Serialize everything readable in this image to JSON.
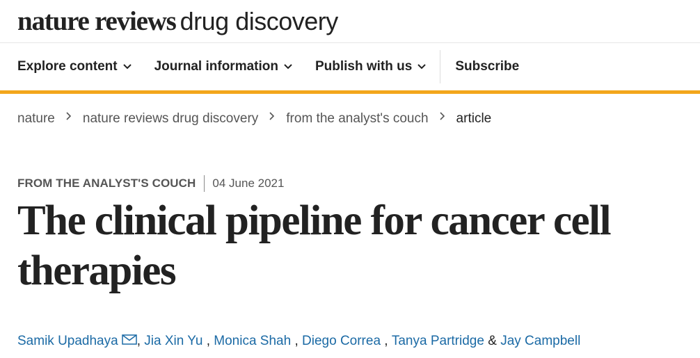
{
  "masthead": {
    "logo_bold": "nature reviews",
    "logo_light": "drug discovery"
  },
  "nav": {
    "items": [
      {
        "label": "Explore content"
      },
      {
        "label": "Journal information"
      },
      {
        "label": "Publish with us"
      }
    ],
    "subscribe": "Subscribe"
  },
  "breadcrumb": [
    "nature",
    "nature reviews drug discovery",
    "from the analyst's couch",
    "article"
  ],
  "article": {
    "type": "FROM THE ANALYST'S COUCH",
    "date": "04 June 2021",
    "title": "The clinical pipeline for cancer cell therapies"
  },
  "authors": {
    "list": [
      "Samik Upadhaya",
      "Jia Xin Yu",
      "Monica Shah",
      "Diego Correa",
      "Tanya Partridge",
      "Jay Campbell"
    ],
    "comma": ",",
    "ampersand": "&"
  },
  "colors": {
    "accent_bar": "#f3a61b",
    "link": "#1b6aa5",
    "text": "#222222"
  },
  "icons": {
    "chevron": "chevron-down-icon",
    "breadcrumb_separator": "chevron-right-icon",
    "corresponding_author": "envelope-icon"
  }
}
